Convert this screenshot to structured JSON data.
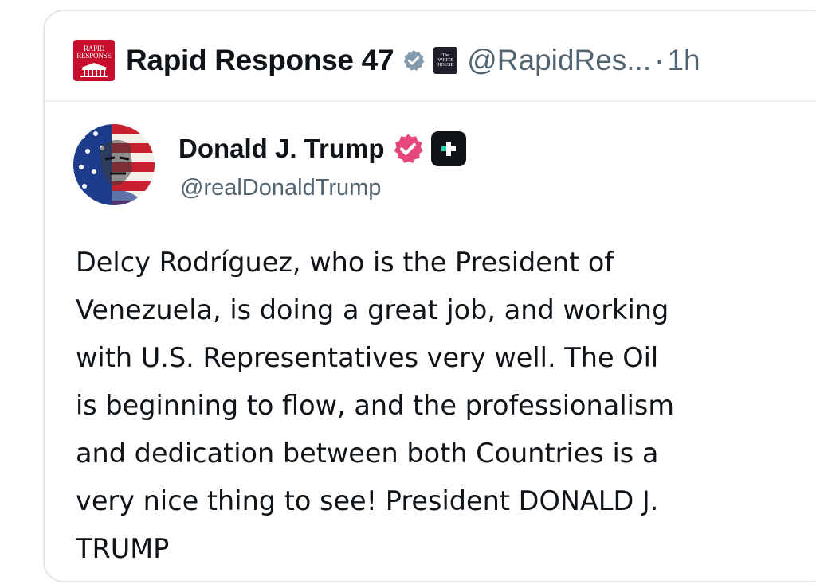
{
  "quoted_header": {
    "logo_text_line1": "RAPID",
    "logo_text_line2": "RESPONSE",
    "account_name": "Rapid Response 47",
    "affiliate_line1": "The",
    "affiliate_line2": "WHITE",
    "affiliate_line3": "HOUSE",
    "handle": "@RapidRes...",
    "separator": "·",
    "time": "1h",
    "verified_icon": "verified-gray-badge-icon",
    "logo_color": "#c8102e"
  },
  "post": {
    "author_name": "Donald J. Trump",
    "author_handle": "@realDonaldTrump",
    "verified_icon": "verified-pink-badge-icon",
    "platform_icon": "truth-social-icon",
    "badge_color": "#e8477e",
    "body_lines": [
      "Delcy Rodríguez, who is the President of",
      "Venezuela, is doing a great job, and working",
      "with U.S. Representatives very well. The Oil",
      "is beginning to flow, and the professionalism",
      "and dedication between both Countries is a",
      "very nice thing to see! President DONALD J.",
      "TRUMP"
    ]
  },
  "colors": {
    "text": "#0f1419",
    "secondary_text": "#536471",
    "border": "#e4e7eb"
  }
}
